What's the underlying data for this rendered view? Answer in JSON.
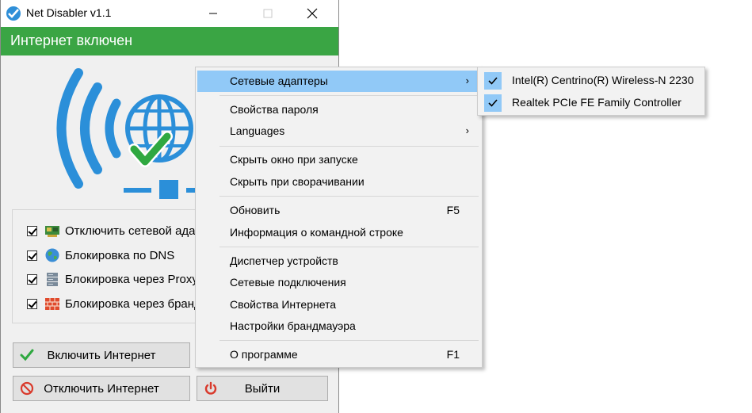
{
  "window": {
    "title": "Net Disabler v1.1",
    "status": "Интернет включен",
    "status_color": "#3aa544",
    "options": [
      {
        "label": "Отключить сетевой адаптер",
        "checked": true,
        "icon": "network-card-icon"
      },
      {
        "label": "Блокировка по DNS",
        "checked": true,
        "icon": "globe-icon"
      },
      {
        "label": "Блокировка через Proxy",
        "checked": true,
        "icon": "server-icon"
      },
      {
        "label": "Блокировка через брандмауэр",
        "checked": true,
        "icon": "firewall-icon"
      }
    ],
    "buttons": {
      "enable": "Включить Интернет",
      "disable": "Отключить Интернет",
      "exit": "Выйти"
    }
  },
  "menu": {
    "items": [
      {
        "label": "Сетевые адаптеры",
        "submenu": true,
        "highlighted": true
      },
      {
        "label": "Свойства пароля"
      },
      {
        "label": "Languages",
        "submenu": true
      },
      {
        "label": "Скрыть окно при запуске"
      },
      {
        "label": "Скрыть при сворачивании"
      },
      {
        "label": "Обновить",
        "shortcut": "F5"
      },
      {
        "label": "Информация о командной строке"
      },
      {
        "label": "Диспетчер устройств"
      },
      {
        "label": "Сетевые подключения"
      },
      {
        "label": "Свойства Интернета"
      },
      {
        "label": "Настройки брандмауэра"
      },
      {
        "label": "О программе",
        "shortcut": "F1"
      }
    ],
    "arrow_glyph": "›",
    "highlight_color": "#91c9f7"
  },
  "submenu": {
    "items": [
      {
        "label": "Intel(R) Centrino(R) Wireless-N 2230",
        "checked": true
      },
      {
        "label": "Realtek PCIe FE Family Controller",
        "checked": true
      }
    ]
  }
}
